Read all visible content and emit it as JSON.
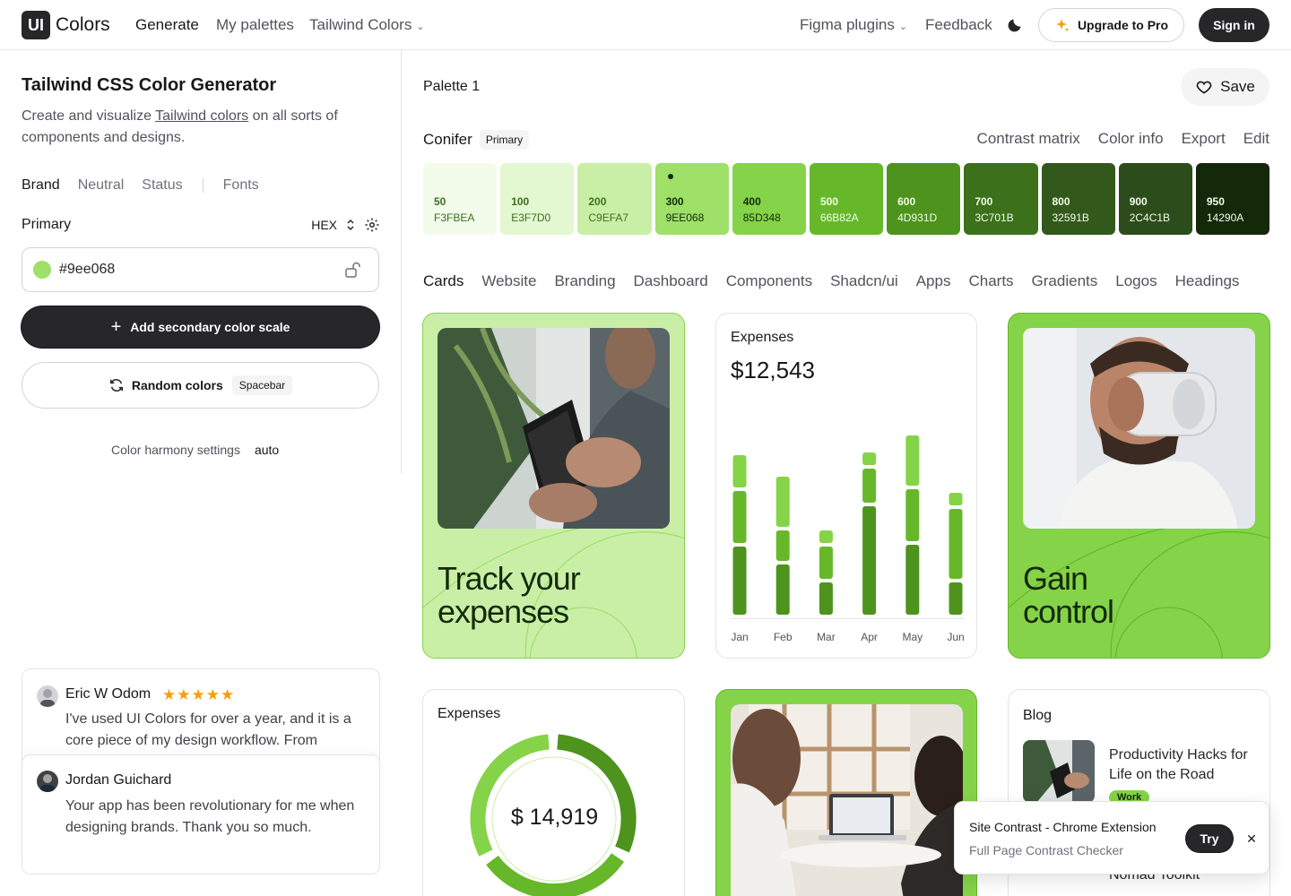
{
  "nav": {
    "logo_mark": "UI",
    "logo_text": "Colors",
    "generate": "Generate",
    "my_palettes": "My palettes",
    "tailwind_colors": "Tailwind Colors",
    "figma_plugins": "Figma plugins",
    "feedback": "Feedback",
    "upgrade": "Upgrade to Pro",
    "signin": "Sign in"
  },
  "left": {
    "title": "Tailwind CSS Color Generator",
    "desc_pre": "Create and visualize ",
    "desc_link": "Tailwind colors",
    "desc_post": " on all sorts of components and designs.",
    "tabs": [
      "Brand",
      "Neutral",
      "Status",
      "Fonts"
    ],
    "primary_label": "Primary",
    "format": "HEX",
    "color_value": "#9ee068",
    "add_secondary": "Add secondary color scale",
    "random": "Random colors",
    "random_kbd": "Spacebar",
    "harmony_label": "Color harmony settings",
    "harmony_value": "auto"
  },
  "testimonials": [
    {
      "name": "Eric W Odom",
      "stars": "★★★★★",
      "text": "I've used UI Colors for over a year, and it is a core piece of my design workflow. From"
    },
    {
      "name": "Jordan Guichard",
      "text": "Your app has been revolutionary for me when designing brands. Thank you so much."
    }
  ],
  "palette": {
    "title": "Palette 1",
    "save": "Save",
    "scale_name": "Conifer",
    "scale_badge": "Primary",
    "links": [
      "Contrast matrix",
      "Color info",
      "Export",
      "Edit"
    ],
    "swatches": [
      {
        "step": "50",
        "hex": "F3FBEA",
        "color": "#f3fbea",
        "text": "#3c701b"
      },
      {
        "step": "100",
        "hex": "E3F7D0",
        "color": "#e3f7d0",
        "text": "#3c701b"
      },
      {
        "step": "200",
        "hex": "C9EFA7",
        "color": "#c9efa7",
        "text": "#3c701b"
      },
      {
        "step": "300",
        "hex": "9EE068",
        "color": "#9ee068",
        "text": "#14290a"
      },
      {
        "step": "400",
        "hex": "85D348",
        "color": "#85d348",
        "text": "#14290a"
      },
      {
        "step": "500",
        "hex": "66B82A",
        "color": "#66b82a",
        "text": "#f3fbea"
      },
      {
        "step": "600",
        "hex": "4D931D",
        "color": "#4d931d",
        "text": "#f3fbea"
      },
      {
        "step": "700",
        "hex": "3C701B",
        "color": "#3c701b",
        "text": "#f3fbea"
      },
      {
        "step": "800",
        "hex": "32591B",
        "color": "#32591b",
        "text": "#f3fbea"
      },
      {
        "step": "900",
        "hex": "2C4C1B",
        "color": "#2c4c1b",
        "text": "#f3fbea"
      },
      {
        "step": "950",
        "hex": "14290A",
        "color": "#14290a",
        "text": "#f3fbea"
      }
    ]
  },
  "tabs": [
    "Cards",
    "Website",
    "Branding",
    "Dashboard",
    "Components",
    "Shadcn/ui",
    "Apps",
    "Charts",
    "Gradients",
    "Logos",
    "Headings"
  ],
  "cards": {
    "track_title_1": "Track your",
    "track_title_2": "expenses",
    "gain_title_1": "Gain",
    "gain_title_2": "control",
    "expenses_label": "Expenses",
    "expenses_value": "$12,543",
    "donut_label": "Expenses",
    "donut_value": "$ 14,919",
    "blog_title": "Blog",
    "blog_item_1": "Productivity Hacks for Life on the Road",
    "blog_tag": "Work",
    "blog_item_2": "Nomad Toolkit"
  },
  "chart_data": {
    "type": "bar",
    "stacked": true,
    "categories": [
      "Jan",
      "Feb",
      "Mar",
      "Apr",
      "May",
      "Jun"
    ],
    "series": [
      {
        "values": [
          80,
          60,
          40,
          125,
          82,
          40
        ],
        "color": "#4d931d"
      },
      {
        "values": [
          62,
          38,
          40,
          42,
          62,
          82
        ],
        "color": "#66b82a"
      },
      {
        "values": [
          40,
          60,
          18,
          18,
          60,
          18
        ],
        "color": "#85d348"
      }
    ],
    "ylim": [
      0,
      210
    ]
  },
  "toast": {
    "title": "Site Contrast - Chrome Extension",
    "subtitle": "Full Page Contrast Checker",
    "try": "Try",
    "close": "✕"
  }
}
